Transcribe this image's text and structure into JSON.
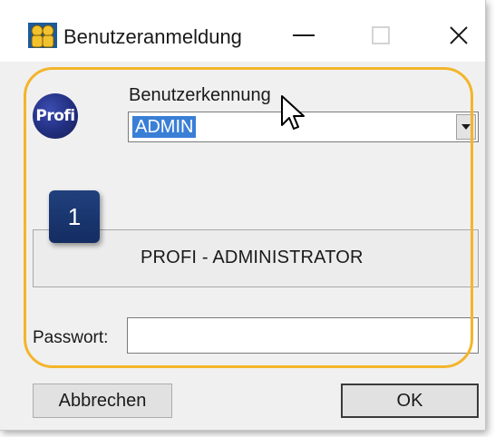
{
  "window": {
    "title": "Benutzeranmeldung",
    "icons": {
      "app": "users-icon",
      "minimize": "minimize-icon",
      "maximize": "maximize-icon",
      "close": "close-icon"
    }
  },
  "logo": {
    "text": "Profi"
  },
  "login": {
    "user_label": "Benutzerkennung",
    "user_value": "ADMIN",
    "full_name": "PROFI - ADMINISTRATOR",
    "password_label": "Passwort:",
    "password_value": ""
  },
  "annotation": {
    "step": "1",
    "highlight_color": "#f3b52a",
    "badge_color": "#1b3670"
  },
  "buttons": {
    "cancel": "Abbrechen",
    "ok": "OK"
  }
}
